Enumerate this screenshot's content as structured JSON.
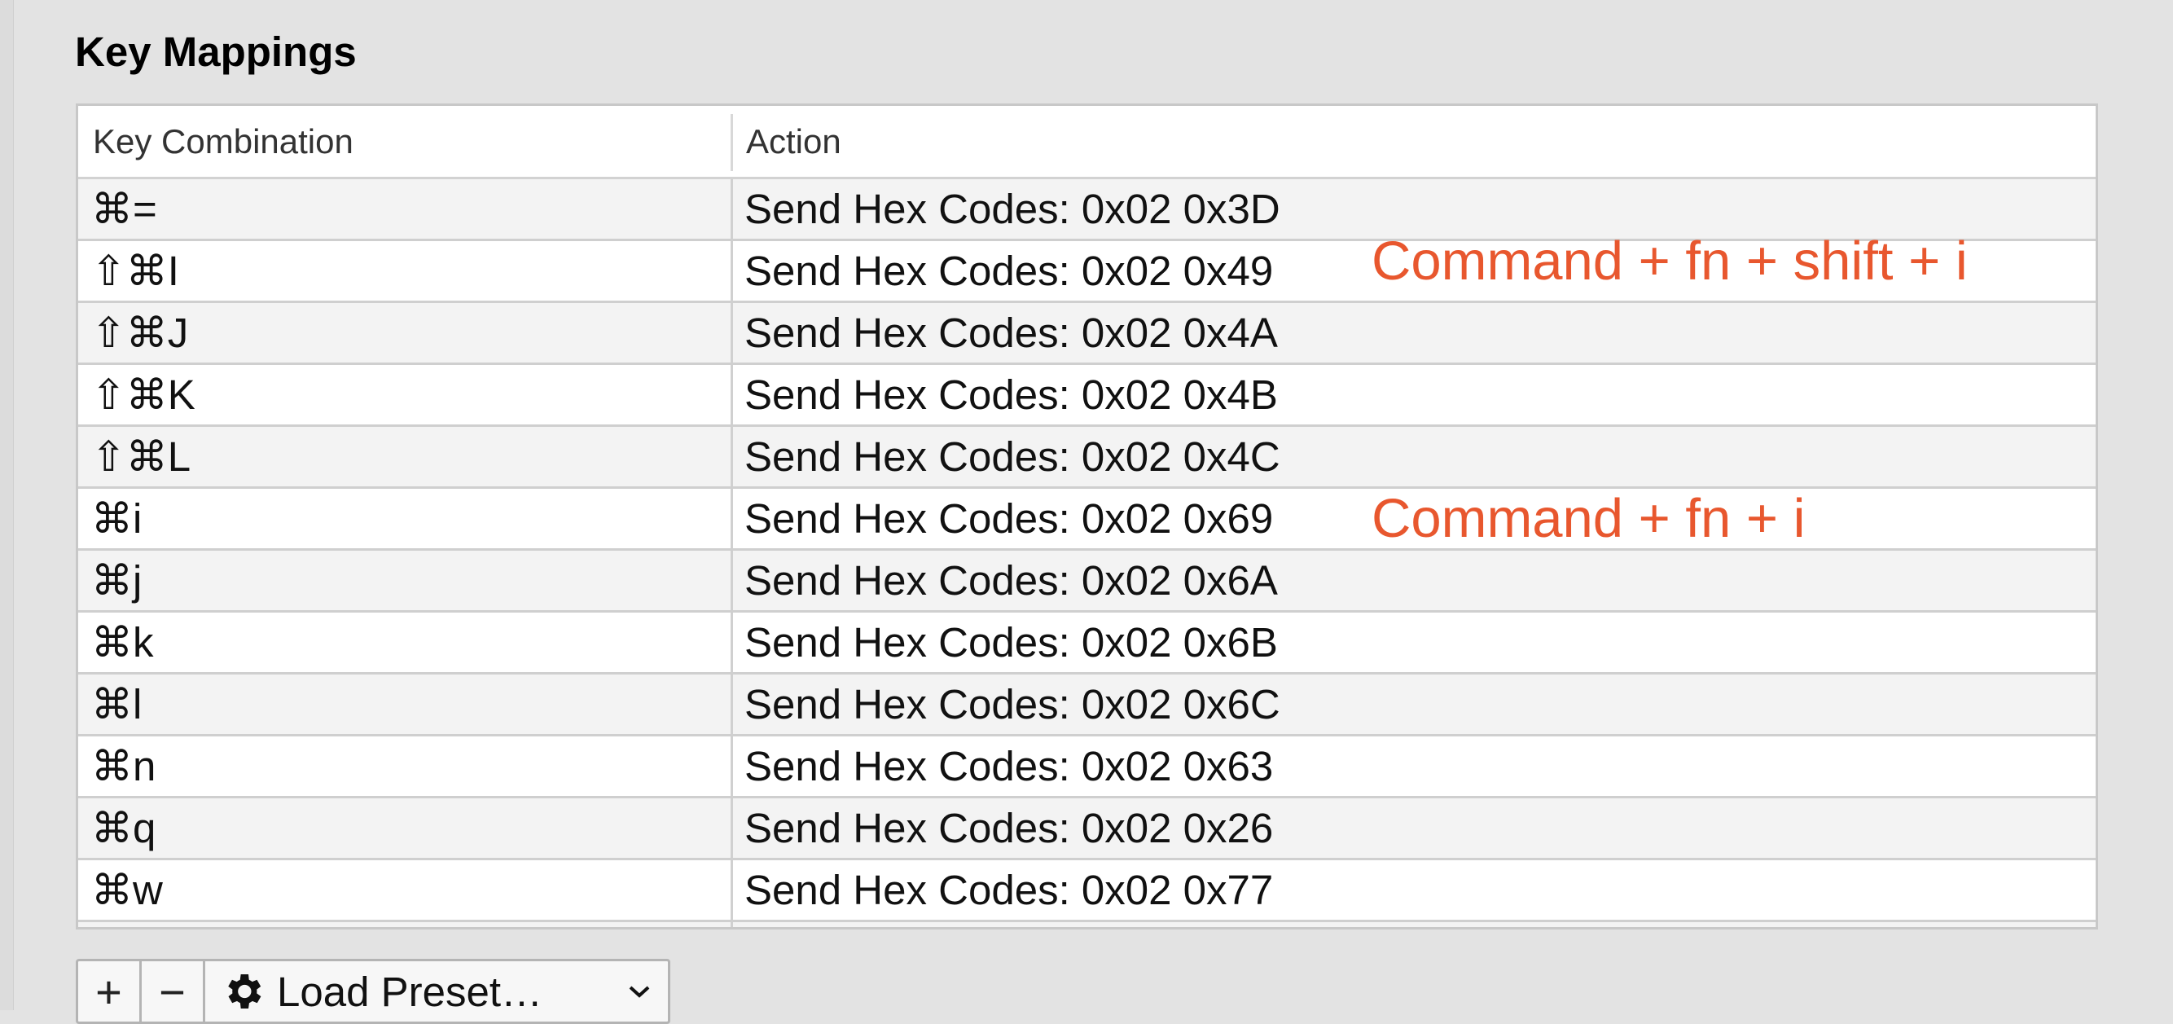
{
  "section": {
    "title": "Key Mappings"
  },
  "table": {
    "headers": {
      "key": "Key Combination",
      "action": "Action"
    },
    "rows": [
      {
        "key": "⌘=",
        "action": "Send Hex Codes: 0x02 0x3D",
        "note": ""
      },
      {
        "key": "⇧⌘I",
        "action": "Send Hex Codes: 0x02 0x49",
        "note": "Command + fn + shift + i"
      },
      {
        "key": "⇧⌘J",
        "action": "Send Hex Codes: 0x02 0x4A",
        "note": ""
      },
      {
        "key": "⇧⌘K",
        "action": "Send Hex Codes: 0x02 0x4B",
        "note": ""
      },
      {
        "key": "⇧⌘L",
        "action": "Send Hex Codes: 0x02 0x4C",
        "note": ""
      },
      {
        "key": "⌘i",
        "action": "Send Hex Codes: 0x02 0x69",
        "note": "Command + fn + i"
      },
      {
        "key": "⌘j",
        "action": "Send Hex Codes: 0x02 0x6A",
        "note": ""
      },
      {
        "key": "⌘k",
        "action": "Send Hex Codes: 0x02 0x6B",
        "note": ""
      },
      {
        "key": "⌘l",
        "action": "Send Hex Codes: 0x02 0x6C",
        "note": ""
      },
      {
        "key": "⌘n",
        "action": "Send Hex Codes: 0x02 0x63",
        "note": ""
      },
      {
        "key": "⌘q",
        "action": "Send Hex Codes: 0x02 0x26",
        "note": ""
      },
      {
        "key": "⌘w",
        "action": "Send Hex Codes: 0x02 0x77",
        "note": ""
      }
    ]
  },
  "toolbar": {
    "add_label": "+",
    "remove_label": "−",
    "preset_label": "Load Preset…",
    "preset_icon": "gear-icon",
    "dropdown_icon": "chevron-down-icon"
  },
  "colors": {
    "annotation": "#e8572e",
    "row_alt": "#f3f3f3",
    "background": "#e3e3e3"
  }
}
